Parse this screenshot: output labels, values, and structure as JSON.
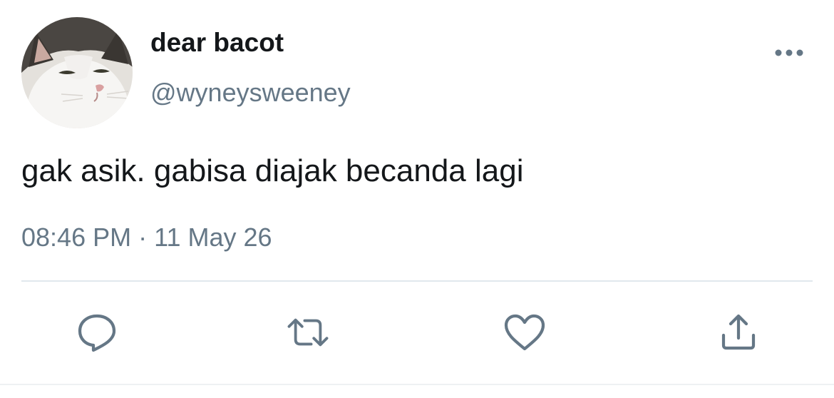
{
  "user": {
    "display_name": "dear bacot",
    "handle": "@wyneysweeney",
    "avatar_icon": "cat-avatar"
  },
  "tweet": {
    "text": "gak asik. gabisa diajak becanda lagi",
    "time": "08:46 PM",
    "separator": "·",
    "date": "11 May 26"
  },
  "icons": {
    "more": "more-horizontal-icon",
    "reply": "reply-icon",
    "retweet": "retweet-icon",
    "like": "heart-icon",
    "share": "share-icon"
  },
  "colors": {
    "text_primary": "#14171a",
    "text_secondary": "#657786",
    "icon": "#657786",
    "divider": "#e1e8ed"
  }
}
